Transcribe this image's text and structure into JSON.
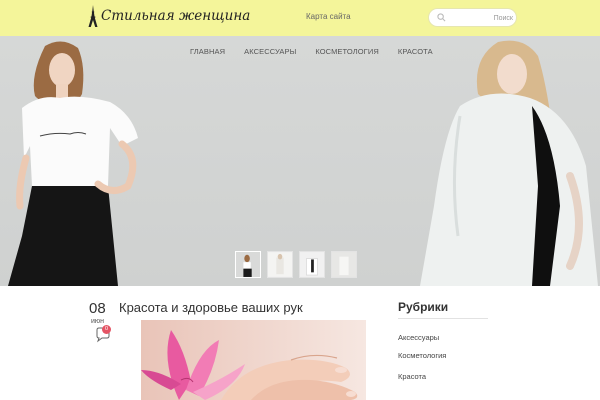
{
  "header": {
    "logo_text": "Стильная женщина",
    "sitemap_label": "Карта сайта",
    "search_placeholder": "Поиск"
  },
  "nav": {
    "items": [
      "ГЛАВНАЯ",
      "АКСЕССУАРЫ",
      "КОСМЕТОЛОГИЯ",
      "КРАСОТА"
    ]
  },
  "slider": {
    "active_index": 0,
    "thumb_count": 4
  },
  "post": {
    "day": "08",
    "month": "июн",
    "comment_count": "0",
    "title": "Красота и здоровье ваших рук"
  },
  "sidebar": {
    "title": "Рубрики",
    "categories": [
      "Аксессуары",
      "Косметология",
      "Красота"
    ]
  },
  "colors": {
    "header_bg": "#f4f59a",
    "badge": "#e45464"
  }
}
